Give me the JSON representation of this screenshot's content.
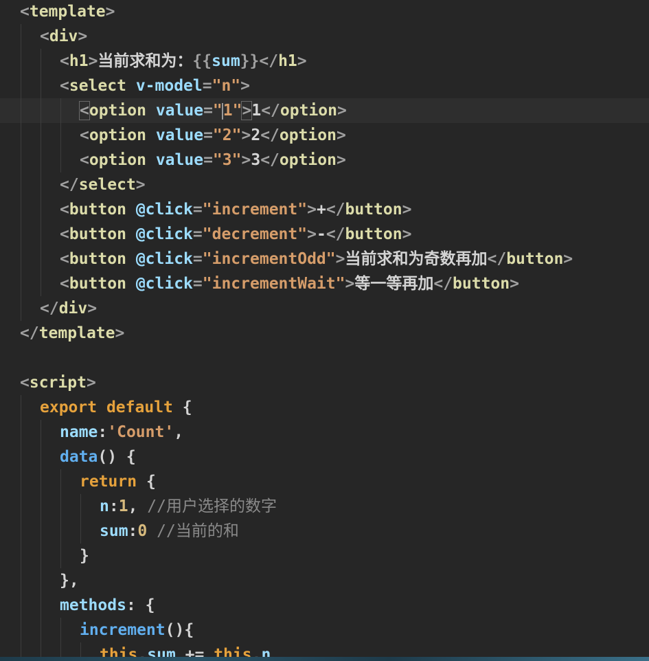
{
  "editor": {
    "lines": [
      {
        "indent": 0,
        "tokens": [
          {
            "t": "<",
            "c": "p"
          },
          {
            "t": "template",
            "c": "t"
          },
          {
            "t": ">",
            "c": "p"
          }
        ]
      },
      {
        "indent": 1,
        "tokens": [
          {
            "t": "<",
            "c": "p"
          },
          {
            "t": "div",
            "c": "t"
          },
          {
            "t": ">",
            "c": "p"
          }
        ]
      },
      {
        "indent": 2,
        "tokens": [
          {
            "t": "<",
            "c": "p"
          },
          {
            "t": "h1",
            "c": "t"
          },
          {
            "t": ">",
            "c": "p"
          },
          {
            "t": "当前求和为：",
            "c": "x"
          },
          {
            "t": "{{",
            "c": "p"
          },
          {
            "t": "sum",
            "c": "a"
          },
          {
            "t": "}}",
            "c": "p"
          },
          {
            "t": "</",
            "c": "p"
          },
          {
            "t": "h1",
            "c": "t"
          },
          {
            "t": ">",
            "c": "p"
          }
        ]
      },
      {
        "indent": 2,
        "tokens": [
          {
            "t": "<",
            "c": "p"
          },
          {
            "t": "select",
            "c": "t"
          },
          {
            "t": " ",
            "c": "x"
          },
          {
            "t": "v-model",
            "c": "a"
          },
          {
            "t": "=",
            "c": "p"
          },
          {
            "t": "\"n\"",
            "c": "s"
          },
          {
            "t": ">",
            "c": "p"
          }
        ]
      },
      {
        "indent": 3,
        "active": true,
        "tokens": [
          {
            "t": "<",
            "c": "p match"
          },
          {
            "t": "option",
            "c": "t"
          },
          {
            "t": " ",
            "c": "x"
          },
          {
            "t": "value",
            "c": "a"
          },
          {
            "t": "=",
            "c": "p"
          },
          {
            "t": "\"",
            "c": "s"
          },
          {
            "t": "",
            "c": "cursor"
          },
          {
            "t": "1\"",
            "c": "s"
          },
          {
            "t": ">",
            "c": "p match"
          },
          {
            "t": "1",
            "c": "x"
          },
          {
            "t": "</",
            "c": "p"
          },
          {
            "t": "option",
            "c": "t"
          },
          {
            "t": ">",
            "c": "p"
          }
        ]
      },
      {
        "indent": 3,
        "tokens": [
          {
            "t": "<",
            "c": "p"
          },
          {
            "t": "option",
            "c": "t"
          },
          {
            "t": " ",
            "c": "x"
          },
          {
            "t": "value",
            "c": "a"
          },
          {
            "t": "=",
            "c": "p"
          },
          {
            "t": "\"2\"",
            "c": "s"
          },
          {
            "t": ">",
            "c": "p"
          },
          {
            "t": "2",
            "c": "x"
          },
          {
            "t": "</",
            "c": "p"
          },
          {
            "t": "option",
            "c": "t"
          },
          {
            "t": ">",
            "c": "p"
          }
        ]
      },
      {
        "indent": 3,
        "tokens": [
          {
            "t": "<",
            "c": "p"
          },
          {
            "t": "option",
            "c": "t"
          },
          {
            "t": " ",
            "c": "x"
          },
          {
            "t": "value",
            "c": "a"
          },
          {
            "t": "=",
            "c": "p"
          },
          {
            "t": "\"3\"",
            "c": "s"
          },
          {
            "t": ">",
            "c": "p"
          },
          {
            "t": "3",
            "c": "x"
          },
          {
            "t": "</",
            "c": "p"
          },
          {
            "t": "option",
            "c": "t"
          },
          {
            "t": ">",
            "c": "p"
          }
        ]
      },
      {
        "indent": 2,
        "tokens": [
          {
            "t": "</",
            "c": "p"
          },
          {
            "t": "select",
            "c": "t"
          },
          {
            "t": ">",
            "c": "p"
          }
        ]
      },
      {
        "indent": 2,
        "tokens": [
          {
            "t": "<",
            "c": "p"
          },
          {
            "t": "button",
            "c": "t"
          },
          {
            "t": " ",
            "c": "x"
          },
          {
            "t": "@click",
            "c": "a"
          },
          {
            "t": "=",
            "c": "p"
          },
          {
            "t": "\"increment\"",
            "c": "s"
          },
          {
            "t": ">",
            "c": "p"
          },
          {
            "t": "+",
            "c": "x"
          },
          {
            "t": "</",
            "c": "p"
          },
          {
            "t": "button",
            "c": "t"
          },
          {
            "t": ">",
            "c": "p"
          }
        ]
      },
      {
        "indent": 2,
        "tokens": [
          {
            "t": "<",
            "c": "p"
          },
          {
            "t": "button",
            "c": "t"
          },
          {
            "t": " ",
            "c": "x"
          },
          {
            "t": "@click",
            "c": "a"
          },
          {
            "t": "=",
            "c": "p"
          },
          {
            "t": "\"decrement\"",
            "c": "s"
          },
          {
            "t": ">",
            "c": "p"
          },
          {
            "t": "-",
            "c": "x"
          },
          {
            "t": "</",
            "c": "p"
          },
          {
            "t": "button",
            "c": "t"
          },
          {
            "t": ">",
            "c": "p"
          }
        ]
      },
      {
        "indent": 2,
        "tokens": [
          {
            "t": "<",
            "c": "p"
          },
          {
            "t": "button",
            "c": "t"
          },
          {
            "t": " ",
            "c": "x"
          },
          {
            "t": "@click",
            "c": "a"
          },
          {
            "t": "=",
            "c": "p"
          },
          {
            "t": "\"incrementOdd\"",
            "c": "s"
          },
          {
            "t": ">",
            "c": "p"
          },
          {
            "t": "当前求和为奇数再加",
            "c": "x"
          },
          {
            "t": "</",
            "c": "p"
          },
          {
            "t": "button",
            "c": "t"
          },
          {
            "t": ">",
            "c": "p"
          }
        ]
      },
      {
        "indent": 2,
        "tokens": [
          {
            "t": "<",
            "c": "p"
          },
          {
            "t": "button",
            "c": "t"
          },
          {
            "t": " ",
            "c": "x"
          },
          {
            "t": "@click",
            "c": "a"
          },
          {
            "t": "=",
            "c": "p"
          },
          {
            "t": "\"incrementWait\"",
            "c": "s"
          },
          {
            "t": ">",
            "c": "p"
          },
          {
            "t": "等一等再加",
            "c": "x"
          },
          {
            "t": "</",
            "c": "p"
          },
          {
            "t": "button",
            "c": "t"
          },
          {
            "t": ">",
            "c": "p"
          }
        ]
      },
      {
        "indent": 1,
        "tokens": [
          {
            "t": "</",
            "c": "p"
          },
          {
            "t": "div",
            "c": "t"
          },
          {
            "t": ">",
            "c": "p"
          }
        ]
      },
      {
        "indent": 0,
        "tokens": [
          {
            "t": "</",
            "c": "p"
          },
          {
            "t": "template",
            "c": "t"
          },
          {
            "t": ">",
            "c": "p"
          }
        ]
      },
      {
        "indent": 0,
        "tokens": []
      },
      {
        "indent": 0,
        "tokens": [
          {
            "t": "<",
            "c": "p"
          },
          {
            "t": "script",
            "c": "t"
          },
          {
            "t": ">",
            "c": "p"
          }
        ]
      },
      {
        "indent": 1,
        "tokens": [
          {
            "t": "export",
            "c": "k"
          },
          {
            "t": " ",
            "c": "x"
          },
          {
            "t": "default",
            "c": "k"
          },
          {
            "t": " {",
            "c": "x"
          }
        ]
      },
      {
        "indent": 2,
        "tokens": [
          {
            "t": "name",
            "c": "a"
          },
          {
            "t": ":",
            "c": "x"
          },
          {
            "t": "'Count'",
            "c": "s"
          },
          {
            "t": ",",
            "c": "x"
          }
        ]
      },
      {
        "indent": 2,
        "tokens": [
          {
            "t": "data",
            "c": "f"
          },
          {
            "t": "() {",
            "c": "x"
          }
        ]
      },
      {
        "indent": 3,
        "tokens": [
          {
            "t": "return",
            "c": "k"
          },
          {
            "t": " {",
            "c": "x"
          }
        ]
      },
      {
        "indent": 4,
        "tokens": [
          {
            "t": "n",
            "c": "a"
          },
          {
            "t": ":",
            "c": "x"
          },
          {
            "t": "1",
            "c": "n"
          },
          {
            "t": ", ",
            "c": "x"
          },
          {
            "t": "//用户选择的数字",
            "c": "c"
          }
        ]
      },
      {
        "indent": 4,
        "tokens": [
          {
            "t": "sum",
            "c": "a"
          },
          {
            "t": ":",
            "c": "x"
          },
          {
            "t": "0",
            "c": "n"
          },
          {
            "t": " ",
            "c": "x"
          },
          {
            "t": "//当前的和",
            "c": "c"
          }
        ]
      },
      {
        "indent": 3,
        "tokens": [
          {
            "t": "}",
            "c": "x"
          }
        ]
      },
      {
        "indent": 2,
        "tokens": [
          {
            "t": "},",
            "c": "x"
          }
        ]
      },
      {
        "indent": 2,
        "tokens": [
          {
            "t": "methods",
            "c": "a"
          },
          {
            "t": ": {",
            "c": "x"
          }
        ]
      },
      {
        "indent": 3,
        "tokens": [
          {
            "t": "increment",
            "c": "f"
          },
          {
            "t": "(){",
            "c": "x"
          }
        ]
      },
      {
        "indent": 4,
        "tokens": [
          {
            "t": "this",
            "c": "k"
          },
          {
            "t": ".",
            "c": "x"
          },
          {
            "t": "sum",
            "c": "a"
          },
          {
            "t": " += ",
            "c": "x"
          },
          {
            "t": "this",
            "c": "k"
          },
          {
            "t": ".",
            "c": "x"
          },
          {
            "t": "n",
            "c": "a"
          }
        ]
      }
    ]
  }
}
